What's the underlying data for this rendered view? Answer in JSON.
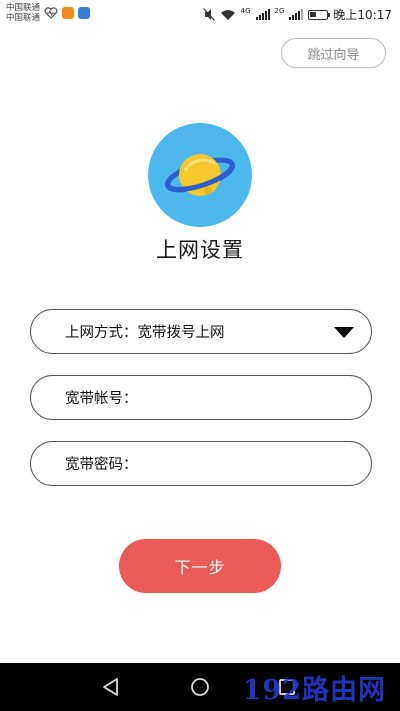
{
  "status_bar": {
    "carrier_1": "中国联通",
    "carrier_2": "中国联通",
    "network_1": "4G",
    "network_2": "2G",
    "battery_level": 0.35,
    "time": "晚上10:17"
  },
  "header": {
    "skip_label": "跳过向导"
  },
  "main": {
    "title": "上网设置",
    "connection_type": {
      "label": "上网方式：",
      "value": "宽带拨号上网"
    },
    "account_field": {
      "label": "宽带帐号："
    },
    "password_field": {
      "label": "宽带密码："
    },
    "next_label": "下一步"
  },
  "colors": {
    "accent": "#ea5a57",
    "logo_bg": "#4db8ee",
    "planet": "#f7c72e",
    "ring": "#2a5fcc"
  },
  "watermark": "192路由网"
}
